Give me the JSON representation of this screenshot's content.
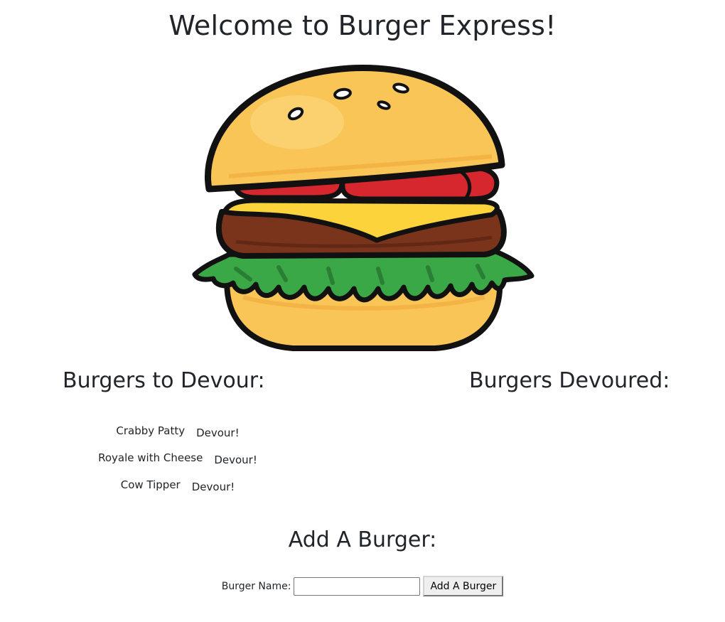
{
  "page": {
    "title": "Welcome to Burger Express!"
  },
  "image": {
    "icon": "burger-illustration",
    "colors": {
      "bun": "#f9c556",
      "cheese": "#fcd33b",
      "tomato": "#d6262e",
      "patty": "#7a341c",
      "lettuce": "#3aa846",
      "outline": "#111111"
    }
  },
  "sections": {
    "to_devour_heading": "Burgers to Devour:",
    "devoured_heading": "Burgers Devoured:"
  },
  "burgers_to_devour": [
    {
      "name": "Crabby Patty",
      "action": "Devour!"
    },
    {
      "name": "Royale with Cheese",
      "action": "Devour!"
    },
    {
      "name": "Cow Tipper",
      "action": "Devour!"
    }
  ],
  "burgers_devoured": [],
  "add_form": {
    "heading": "Add A Burger:",
    "label": "Burger Name:",
    "input_value": "",
    "submit_label": "Add A Burger"
  }
}
